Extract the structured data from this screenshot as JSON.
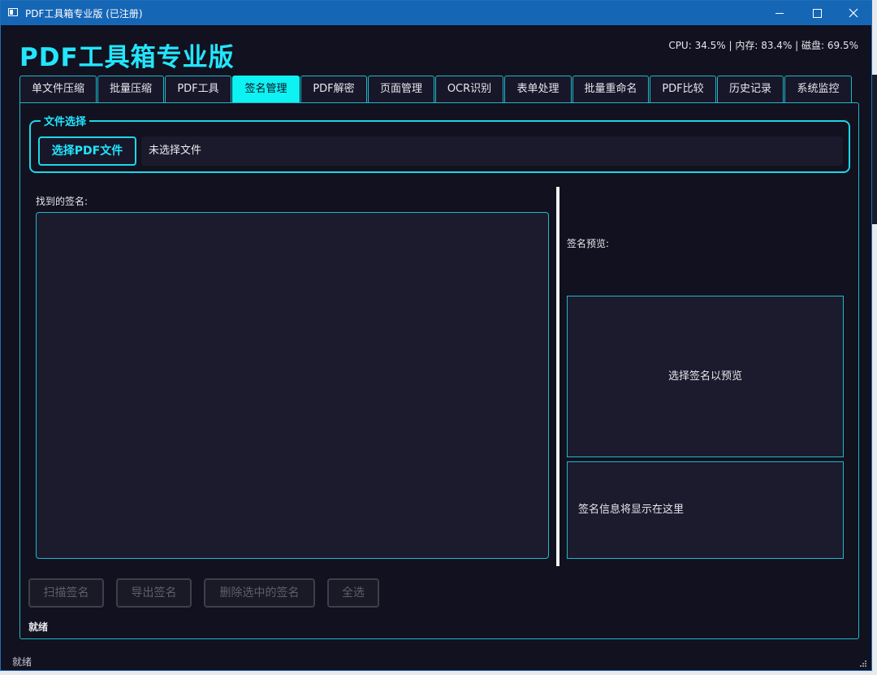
{
  "window": {
    "title": "PDF工具箱专业版 (已注册)"
  },
  "header": {
    "app_title": "PDF工具箱专业版",
    "system_monitor": "CPU: 34.5% | 内存: 83.4% | 磁盘: 69.5%"
  },
  "tabs": [
    {
      "label": "单文件压缩"
    },
    {
      "label": "批量压缩"
    },
    {
      "label": "PDF工具"
    },
    {
      "label": "签名管理",
      "active": true
    },
    {
      "label": "PDF解密"
    },
    {
      "label": "页面管理"
    },
    {
      "label": "OCR识别"
    },
    {
      "label": "表单处理"
    },
    {
      "label": "批量重命名"
    },
    {
      "label": "PDF比较"
    },
    {
      "label": "历史记录"
    },
    {
      "label": "系统监控"
    }
  ],
  "file_select": {
    "group_label": "文件选择",
    "button_label": "选择PDF文件",
    "file_path": "未选择文件"
  },
  "signatures": {
    "list_label": "找到的签名:",
    "preview_label": "签名预览:",
    "preview_placeholder": "选择签名以预览",
    "info_placeholder": "签名信息将显示在这里"
  },
  "actions": {
    "scan": "扫描签名",
    "export": "导出签名",
    "delete_selected": "删除选中的签名",
    "select_all": "全选"
  },
  "status": {
    "inner": "就绪",
    "bar": "就绪"
  },
  "colors": {
    "accent": "#22e6ff",
    "active_tab": "#0df2f2",
    "background": "#11111f",
    "titlebar": "#1666b6"
  }
}
